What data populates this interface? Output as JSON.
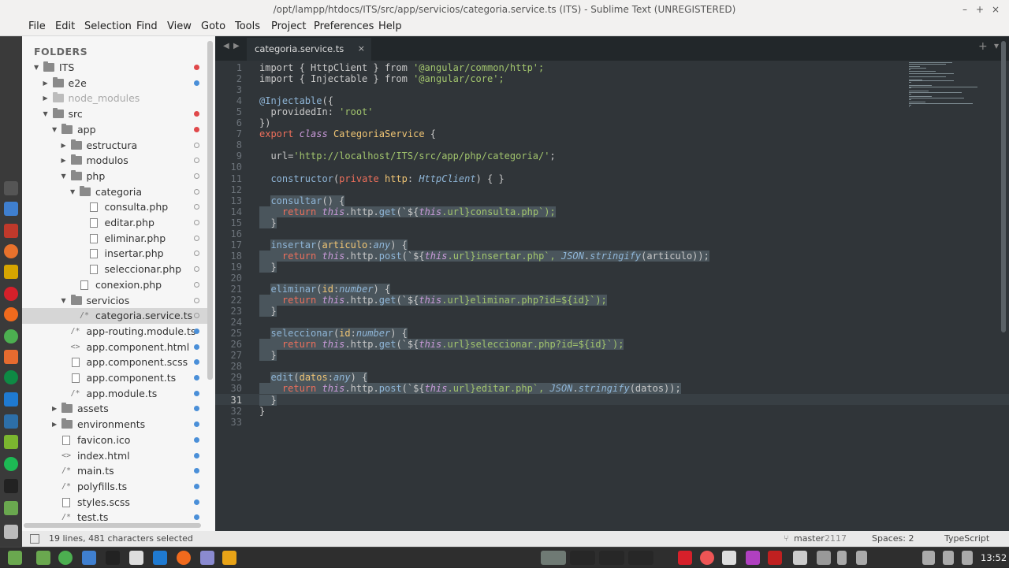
{
  "window": {
    "title": "/opt/lampp/htdocs/ITS/src/app/servicios/categoria.service.ts (ITS) - Sublime Text (UNREGISTERED)",
    "minimize_icon": "–",
    "maximize_icon": "+",
    "close_icon": "×"
  },
  "menu": [
    "File",
    "Edit",
    "Selection",
    "Find",
    "View",
    "Goto",
    "Tools",
    "Project",
    "Preferences",
    "Help"
  ],
  "sidebar": {
    "header": "FOLDERS",
    "items": [
      {
        "label": "ITS",
        "indent": 0,
        "kind": "folder",
        "open": true,
        "mark": "red"
      },
      {
        "label": "e2e",
        "indent": 1,
        "kind": "folder",
        "open": false,
        "mark": "blue"
      },
      {
        "label": "node_modules",
        "indent": 1,
        "kind": "folder",
        "open": false,
        "mark": "",
        "dim": true
      },
      {
        "label": "src",
        "indent": 1,
        "kind": "folder",
        "open": true,
        "mark": "red"
      },
      {
        "label": "app",
        "indent": 2,
        "kind": "folder",
        "open": true,
        "mark": "red"
      },
      {
        "label": "estructura",
        "indent": 3,
        "kind": "folder",
        "open": false,
        "mark": "ring"
      },
      {
        "label": "modulos",
        "indent": 3,
        "kind": "folder",
        "open": false,
        "mark": "ring"
      },
      {
        "label": "php",
        "indent": 3,
        "kind": "folder",
        "open": true,
        "mark": "ring"
      },
      {
        "label": "categoria",
        "indent": 4,
        "kind": "folder",
        "open": true,
        "mark": "ring"
      },
      {
        "label": "consulta.php",
        "indent": 5,
        "kind": "file",
        "mark": "ring"
      },
      {
        "label": "editar.php",
        "indent": 5,
        "kind": "file",
        "mark": "ring"
      },
      {
        "label": "eliminar.php",
        "indent": 5,
        "kind": "file",
        "mark": "ring"
      },
      {
        "label": "insertar.php",
        "indent": 5,
        "kind": "file",
        "mark": "ring"
      },
      {
        "label": "seleccionar.php",
        "indent": 5,
        "kind": "file",
        "mark": "ring"
      },
      {
        "label": "conexion.php",
        "indent": 4,
        "kind": "file",
        "mark": "ring"
      },
      {
        "label": "servicios",
        "indent": 3,
        "kind": "folder",
        "open": true,
        "mark": "ring"
      },
      {
        "label": "categoria.service.ts",
        "indent": 4,
        "kind": "glyph",
        "glyph": "/*",
        "mark": "ring",
        "selected": true
      },
      {
        "label": "app-routing.module.ts",
        "indent": 3,
        "kind": "glyph",
        "glyph": "/*",
        "mark": "blue"
      },
      {
        "label": "app.component.html",
        "indent": 3,
        "kind": "glyph",
        "glyph": "<>",
        "mark": "blue"
      },
      {
        "label": "app.component.scss",
        "indent": 3,
        "kind": "file",
        "mark": "blue"
      },
      {
        "label": "app.component.ts",
        "indent": 3,
        "kind": "file",
        "mark": "blue"
      },
      {
        "label": "app.module.ts",
        "indent": 3,
        "kind": "glyph",
        "glyph": "/*",
        "mark": "blue"
      },
      {
        "label": "assets",
        "indent": 2,
        "kind": "folder",
        "open": false,
        "mark": "blue"
      },
      {
        "label": "environments",
        "indent": 2,
        "kind": "folder",
        "open": false,
        "mark": "blue"
      },
      {
        "label": "favicon.ico",
        "indent": 2,
        "kind": "file",
        "mark": "blue"
      },
      {
        "label": "index.html",
        "indent": 2,
        "kind": "glyph",
        "glyph": "<>",
        "mark": "blue"
      },
      {
        "label": "main.ts",
        "indent": 2,
        "kind": "glyph",
        "glyph": "/*",
        "mark": "blue"
      },
      {
        "label": "polyfills.ts",
        "indent": 2,
        "kind": "glyph",
        "glyph": "/*",
        "mark": "blue"
      },
      {
        "label": "styles.scss",
        "indent": 2,
        "kind": "file",
        "mark": "blue"
      },
      {
        "label": "test.ts",
        "indent": 2,
        "kind": "glyph",
        "glyph": "/*",
        "mark": "blue"
      }
    ]
  },
  "tab": {
    "label": "categoria.service.ts",
    "close": "×"
  },
  "tabbar_icons": {
    "prev": "◀",
    "next": "▶",
    "add": "+",
    "dropdown": "▾"
  },
  "editor": {
    "current_line": 31,
    "lines": [
      [
        [
          "import",
          "p"
        ],
        [
          " { HttpClient } ",
          "p"
        ],
        [
          "from",
          "p"
        ],
        [
          " '@angular/common/http';",
          "s"
        ]
      ],
      [
        [
          "import",
          "p"
        ],
        [
          " { Injectable } ",
          "p"
        ],
        [
          "from",
          "p"
        ],
        [
          " '@angular/core';",
          "s"
        ]
      ],
      [],
      [
        [
          "@Injectable",
          "f"
        ],
        [
          "({",
          "p"
        ]
      ],
      [
        [
          "  providedIn: ",
          "p"
        ],
        [
          "'root'",
          "s"
        ]
      ],
      [
        [
          "})",
          "p"
        ]
      ],
      [
        [
          "export",
          "k"
        ],
        [
          " ",
          "p"
        ],
        [
          "class",
          "i"
        ],
        [
          " CategoriaService",
          "t"
        ],
        [
          " {",
          "p"
        ]
      ],
      [],
      [
        [
          "  url=",
          "p"
        ],
        [
          "'http://localhost/ITS/src/app/php/categoria/'",
          "s"
        ],
        [
          ";",
          "p"
        ]
      ],
      [],
      [
        [
          "  ",
          "p"
        ],
        [
          "constructor",
          "f"
        ],
        [
          "(",
          "p"
        ],
        [
          "private",
          "k"
        ],
        [
          " http",
          "t"
        ],
        [
          ": ",
          "p"
        ],
        [
          "HttpClient",
          "c"
        ],
        [
          ") { }",
          "p"
        ]
      ],
      [],
      [
        [
          "  ",
          "p"
        ],
        [
          "consultar",
          "f",
          "h"
        ],
        [
          "() {",
          "p",
          "h"
        ]
      ],
      [
        [
          "    ",
          "p",
          "h"
        ],
        [
          "return",
          "k",
          "h"
        ],
        [
          " ",
          "p",
          "h"
        ],
        [
          "this",
          "i",
          "h"
        ],
        [
          ".http.",
          "p",
          "h"
        ],
        [
          "get",
          "f",
          "h"
        ],
        [
          "(`${",
          "p",
          "h"
        ],
        [
          "this",
          "i",
          "h"
        ],
        [
          ".url}consulta.php`);",
          "s",
          "h"
        ]
      ],
      [
        [
          "  }",
          "p",
          "h"
        ]
      ],
      [],
      [
        [
          "  ",
          "p"
        ],
        [
          "insertar",
          "f",
          "h"
        ],
        [
          "(",
          "p",
          "h"
        ],
        [
          "articulo",
          "t",
          "h"
        ],
        [
          ":",
          "p",
          "h"
        ],
        [
          "any",
          "c",
          "h"
        ],
        [
          ") {",
          "p",
          "h"
        ]
      ],
      [
        [
          "    ",
          "p",
          "h"
        ],
        [
          "return",
          "k",
          "h"
        ],
        [
          " ",
          "p",
          "h"
        ],
        [
          "this",
          "i",
          "h"
        ],
        [
          ".http.",
          "p",
          "h"
        ],
        [
          "post",
          "f",
          "h"
        ],
        [
          "(`${",
          "p",
          "h"
        ],
        [
          "this",
          "i",
          "h"
        ],
        [
          ".url}insertar.php`, ",
          "s",
          "h"
        ],
        [
          "JSON",
          "c",
          "h"
        ],
        [
          ".",
          "p",
          "h"
        ],
        [
          "stringify",
          "c",
          "h"
        ],
        [
          "(articulo));",
          "p",
          "h"
        ]
      ],
      [
        [
          "  }",
          "p",
          "h"
        ]
      ],
      [],
      [
        [
          "  ",
          "p"
        ],
        [
          "eliminar",
          "f",
          "h"
        ],
        [
          "(",
          "p",
          "h"
        ],
        [
          "id",
          "t",
          "h"
        ],
        [
          ":",
          "p",
          "h"
        ],
        [
          "number",
          "c",
          "h"
        ],
        [
          ") {",
          "p",
          "h"
        ]
      ],
      [
        [
          "    ",
          "p",
          "h"
        ],
        [
          "return",
          "k",
          "h"
        ],
        [
          " ",
          "p",
          "h"
        ],
        [
          "this",
          "i",
          "h"
        ],
        [
          ".http.",
          "p",
          "h"
        ],
        [
          "get",
          "f",
          "h"
        ],
        [
          "(`${",
          "p",
          "h"
        ],
        [
          "this",
          "i",
          "h"
        ],
        [
          ".url}eliminar.php?id=${id}`);",
          "s",
          "h"
        ]
      ],
      [
        [
          "  }",
          "p",
          "h"
        ]
      ],
      [],
      [
        [
          "  ",
          "p"
        ],
        [
          "seleccionar",
          "f",
          "h"
        ],
        [
          "(",
          "p",
          "h"
        ],
        [
          "id",
          "t",
          "h"
        ],
        [
          ":",
          "p",
          "h"
        ],
        [
          "number",
          "c",
          "h"
        ],
        [
          ") {",
          "p",
          "h"
        ]
      ],
      [
        [
          "    ",
          "p",
          "h"
        ],
        [
          "return",
          "k",
          "h"
        ],
        [
          " ",
          "p",
          "h"
        ],
        [
          "this",
          "i",
          "h"
        ],
        [
          ".http.",
          "p",
          "h"
        ],
        [
          "get",
          "f",
          "h"
        ],
        [
          "(`${",
          "p",
          "h"
        ],
        [
          "this",
          "i",
          "h"
        ],
        [
          ".url}seleccionar.php?id=${id}`);",
          "s",
          "h"
        ]
      ],
      [
        [
          "  }",
          "p",
          "h"
        ]
      ],
      [],
      [
        [
          "  ",
          "p"
        ],
        [
          "edit",
          "f",
          "h"
        ],
        [
          "(",
          "p",
          "h"
        ],
        [
          "datos",
          "t",
          "h"
        ],
        [
          ":",
          "p",
          "h"
        ],
        [
          "any",
          "c",
          "h"
        ],
        [
          ") {",
          "p",
          "h"
        ]
      ],
      [
        [
          "    ",
          "p",
          "h"
        ],
        [
          "return",
          "k",
          "h"
        ],
        [
          " ",
          "p",
          "h"
        ],
        [
          "this",
          "i",
          "h"
        ],
        [
          ".http.",
          "p",
          "h"
        ],
        [
          "post",
          "f",
          "h"
        ],
        [
          "(`${",
          "p",
          "h"
        ],
        [
          "this",
          "i",
          "h"
        ],
        [
          ".url}editar.php`, ",
          "s",
          "h"
        ],
        [
          "JSON",
          "c",
          "h"
        ],
        [
          ".",
          "p",
          "h"
        ],
        [
          "stringify",
          "c",
          "h"
        ],
        [
          "(datos));",
          "p",
          "h"
        ]
      ],
      [
        [
          "  }",
          "p",
          "h"
        ]
      ],
      [
        [
          "}",
          "p"
        ]
      ],
      []
    ]
  },
  "status": {
    "selection": "19 lines, 481 characters selected",
    "branch": "master",
    "branch_count": "2117",
    "spaces": "Spaces: 2",
    "syntax": "TypeScript"
  },
  "clock": "13:52",
  "colors": {
    "editor_bg": "#303539",
    "selection": "#4a555c",
    "keyword": "#ee6f5b",
    "string": "#a2c56d",
    "function": "#8fb6d8",
    "type": "#f0c574"
  }
}
